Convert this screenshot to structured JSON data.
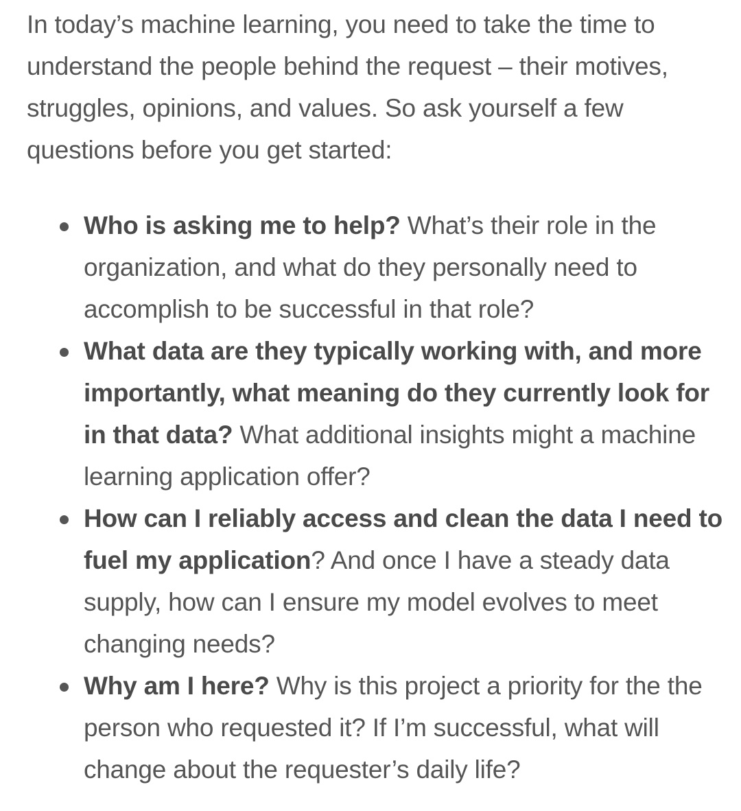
{
  "intro": "In today’s machine learning, you need to take the time to understand the people behind the request – their motives, struggles, opinions, and values. So ask yourself a few questions before you get started:",
  "questions": [
    {
      "bold": "Who is asking me to help?",
      "lead": "",
      "text": " What’s their role in the organization, and what do they personally need to accomplish to be successful in that role?"
    },
    {
      "bold": "What data are they typically working with, and more importantly, what meaning do they currently look for in that data?",
      "lead": "",
      "text": " What additional insights might a machine learning application offer?"
    },
    {
      "bold": "How can I reliably access and clean the data I need to fuel my application",
      "lead": "",
      "text": "? And once I have a steady data supply, how can I ensure my model evolves to meet changing needs?"
    },
    {
      "bold": "Why am I here?",
      "lead": "",
      "text": " Why is this project a priority for the the person who requested it? If I’m successful, what will change about the requester’s daily life?"
    }
  ]
}
